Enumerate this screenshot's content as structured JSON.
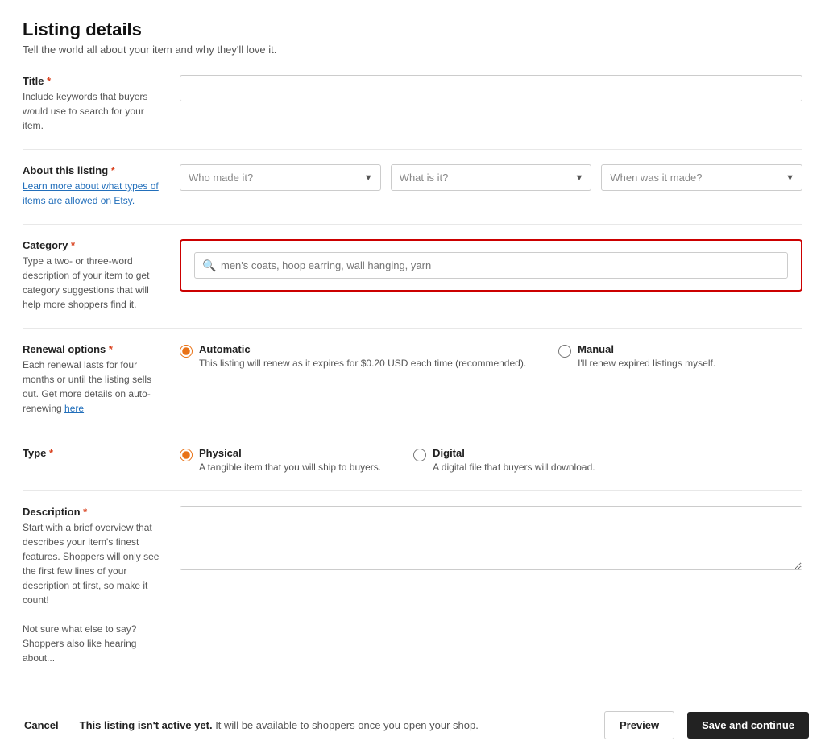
{
  "page": {
    "title": "Listing details",
    "subtitle": "Tell the world all about your item and why they'll love it."
  },
  "fields": {
    "title": {
      "label": "Title",
      "required": true,
      "hint": "Include keywords that buyers would use to search for your item.",
      "placeholder": ""
    },
    "about": {
      "label": "About this listing",
      "required": true,
      "link_text": "Learn more about what types of items are allowed on Etsy.",
      "dropdowns": [
        {
          "placeholder": "Who made it?"
        },
        {
          "placeholder": "What is it?"
        },
        {
          "placeholder": "When was it made?"
        }
      ]
    },
    "category": {
      "label": "Category",
      "required": true,
      "hint": "Type a two- or three-word description of your item to get category suggestions that will help more shoppers find it.",
      "placeholder": "men's coats, hoop earring, wall hanging, yarn"
    },
    "renewal": {
      "label": "Renewal options",
      "required": true,
      "hint": "Each renewal lasts for four months or until the listing sells out. Get more details on auto-renewing",
      "link_text": "here",
      "options": [
        {
          "value": "automatic",
          "label": "Automatic",
          "description": "This listing will renew as it expires for $0.20 USD each time (recommended).",
          "selected": true
        },
        {
          "value": "manual",
          "label": "Manual",
          "description": "I'll renew expired listings myself.",
          "selected": false
        }
      ]
    },
    "type": {
      "label": "Type",
      "required": true,
      "options": [
        {
          "value": "physical",
          "label": "Physical",
          "description": "A tangible item that you will ship to buyers.",
          "selected": true
        },
        {
          "value": "digital",
          "label": "Digital",
          "description": "A digital file that buyers will download.",
          "selected": false
        }
      ]
    },
    "description": {
      "label": "Description",
      "required": true,
      "hint": "Start with a brief overview that describes your item's finest features. Shoppers will only see the first few lines of your description at first, so make it count!\n\nNot sure what else to say? Shoppers also like hearing about...",
      "placeholder": ""
    }
  },
  "bottom_bar": {
    "cancel_label": "Cancel",
    "inactive_text_bold": "This listing isn't active yet.",
    "inactive_text": " It will be available to shoppers once you open your shop.",
    "preview_label": "Preview",
    "save_label": "Save and continue"
  }
}
